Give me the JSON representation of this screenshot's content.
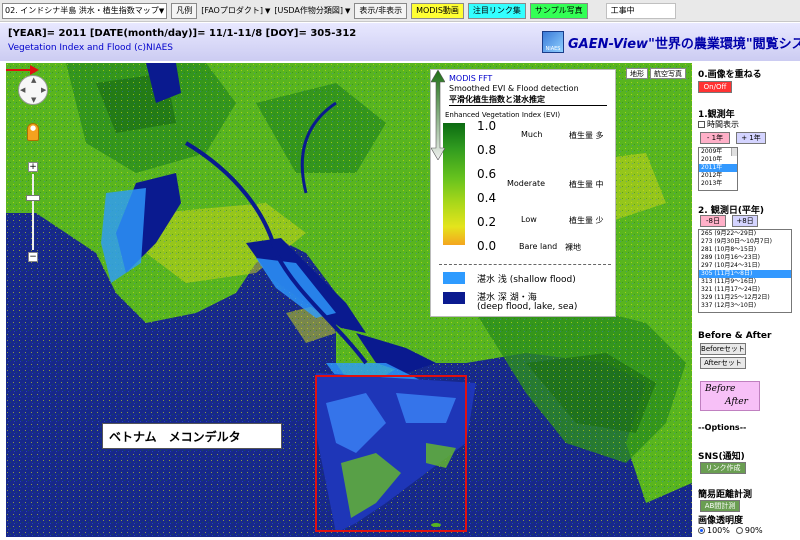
{
  "toolbar": {
    "layer_select": "02. インドシナ半島 洪水・植生指数マップ",
    "legend_button": "凡例",
    "fao_product": "[FAOプロダクト]",
    "usda_crop": "[USDA作物分類図]",
    "toggle_display": "表示/非表示",
    "modis_video": "MODIS動画",
    "featured_links": "注目リンク集",
    "sample_photos": "サンプル写真",
    "status": "工事中"
  },
  "header": {
    "line1": "[YEAR]= 2011 [DATE(month/day)]= 11/1-11/8 [DOY]= 305-312",
    "line2": "Vegetation Index and Flood (c)NIAES",
    "brand": "GAEN-View",
    "subtitle": "\"世界の農業環境\"閲覧システム",
    "logo_text": "NIAES"
  },
  "map": {
    "map_type_map": "地形",
    "map_type_photo": "航空写真",
    "annotation_label": "ベトナム　メコンデルタ"
  },
  "legend": {
    "title": "MODIS FFT",
    "subtitle": "Smoothed EVI & Flood detection",
    "subtitle_jp": "平滑化植生指数と湛水推定",
    "evi_label": "Enhanced Vegetation Index (EVI)",
    "ticks": [
      "1.0",
      "0.8",
      "0.6",
      "0.4",
      "0.2",
      "0.0"
    ],
    "much": "Much",
    "moderate": "Moderate",
    "low": "Low",
    "bare_land": "Bare land",
    "bare_land_jp": "裸地",
    "veg_much_jp": "植生量 多",
    "veg_mid_jp": "植生量 中",
    "veg_low_jp": "植生量 少",
    "shallow_flood": "湛水 浅 (shallow flood)",
    "deep_flood_1": "湛水 深 湖・海",
    "deep_flood_2": "(deep flood, lake, sea)",
    "colors": {
      "shallow": "#2e9bff",
      "deep": "#0a1a8f"
    }
  },
  "panel": {
    "overlay_heading": "0.画像を重ねる",
    "onoff_button": "On/Off",
    "year_heading": "1.観測年",
    "time_display": "時間表示",
    "prev_year": "- 1年",
    "next_year": "+ 1年",
    "years": [
      "2009年",
      "2010年",
      "2011年",
      "2012年",
      "2013年"
    ],
    "selected_year": "2011年",
    "date_heading": "2. 観測日(平年)",
    "prev_8d": "-8日",
    "next_8d": "+8日",
    "dates": [
      "265 (9月22〜29日)",
      "273 (9月30日〜10月7日)",
      "281 (10月8〜15日)",
      "289 (10月16〜23日)",
      "297 (10月24〜31日)",
      "305 (11月1〜8日)",
      "313 (11月9〜16日)",
      "321 (11月17〜24日)",
      "329 (11月25〜12月2日)",
      "337 (12月3〜10日)"
    ],
    "selected_date": "305 (11月1〜8日)",
    "ba_heading": "Before & After",
    "before_set": "Beforeセット",
    "after_set": "Afterセット",
    "ba_before": "Before",
    "ba_after": "After",
    "options": "--Options--",
    "sns_heading": "SNS(通知)",
    "link_create": "リンク作成",
    "distance_heading": "簡易距離計測",
    "ab_measure": "AB間計測",
    "opacity_heading": "画像透明度",
    "opacity_100": "100%",
    "opacity_90": "90%"
  }
}
